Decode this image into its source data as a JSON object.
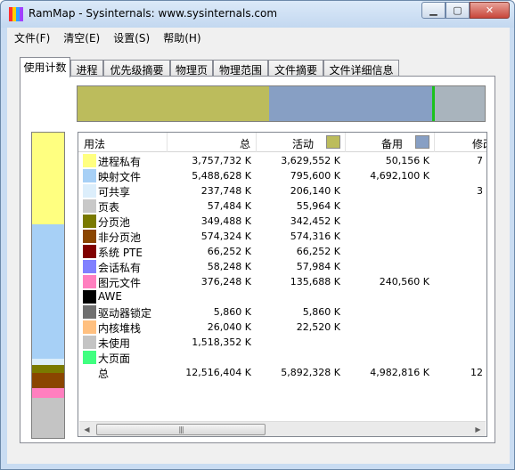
{
  "window": {
    "title": "RamMap - Sysinternals: www.sysinternals.com"
  },
  "menu": [
    "文件(F)",
    "清空(E)",
    "设置(S)",
    "帮助(H)"
  ],
  "tabs": [
    "使用计数",
    "进程",
    "优先级摘要",
    "物理页",
    "物理范围",
    "文件摘要",
    "文件详细信息"
  ],
  "active_tab": "使用计数",
  "topbar": [
    {
      "color": "#bcbc5c",
      "fraction": 0.47
    },
    {
      "color": "#879fc4",
      "fraction": 0.4
    },
    {
      "color": "#1cc21c",
      "fraction": 0.008
    },
    {
      "color": "#a9b4bd",
      "fraction": 0.122
    }
  ],
  "vbar": [
    {
      "color": "#ffff80",
      "fraction": 0.3
    },
    {
      "color": "#a7d0f6",
      "fraction": 0.44
    },
    {
      "color": "#dceefb",
      "fraction": 0.02
    },
    {
      "color": "#7a7a00",
      "fraction": 0.028
    },
    {
      "color": "#8a4500",
      "fraction": 0.048
    },
    {
      "color": "#ff7fbf",
      "fraction": 0.034
    },
    {
      "color": "#c4c4c4",
      "fraction": 0.13
    }
  ],
  "columns": {
    "usage": "用法",
    "total": "总",
    "active": "活动",
    "standby": "备用",
    "modified": "修改",
    "active_color": "#bcbc5c",
    "standby_color": "#879fc4"
  },
  "rows": [
    {
      "name": "进程私有",
      "color": "#ffff80",
      "total": "3,757,732 K",
      "active": "3,629,552 K",
      "standby": "50,156 K",
      "modified": "7"
    },
    {
      "name": "映射文件",
      "color": "#a7d0f6",
      "total": "5,488,628 K",
      "active": "795,600 K",
      "standby": "4,692,100 K",
      "modified": ""
    },
    {
      "name": "可共享",
      "color": "#dceefb",
      "total": "237,748 K",
      "active": "206,140 K",
      "standby": "",
      "modified": "3"
    },
    {
      "name": "页表",
      "color": "#c8c8c8",
      "total": "57,484 K",
      "active": "55,964 K",
      "standby": "",
      "modified": ""
    },
    {
      "name": "分页池",
      "color": "#7a7a00",
      "total": "349,488 K",
      "active": "342,452 K",
      "standby": "",
      "modified": ""
    },
    {
      "name": "非分页池",
      "color": "#8a4500",
      "total": "574,324 K",
      "active": "574,316 K",
      "standby": "",
      "modified": ""
    },
    {
      "name": "系统 PTE",
      "color": "#800000",
      "total": "66,252 K",
      "active": "66,252 K",
      "standby": "",
      "modified": ""
    },
    {
      "name": "会话私有",
      "color": "#8080ff",
      "total": "58,248 K",
      "active": "57,984 K",
      "standby": "",
      "modified": ""
    },
    {
      "name": "图元文件",
      "color": "#ff7fbf",
      "total": "376,248 K",
      "active": "135,688 K",
      "standby": "240,560 K",
      "modified": ""
    },
    {
      "name": "AWE",
      "color": "#000000",
      "total": "",
      "active": "",
      "standby": "",
      "modified": ""
    },
    {
      "name": "驱动器锁定",
      "color": "#707070",
      "total": "5,860 K",
      "active": "5,860 K",
      "standby": "",
      "modified": ""
    },
    {
      "name": "内核堆栈",
      "color": "#ffc080",
      "total": "26,040 K",
      "active": "22,520 K",
      "standby": "",
      "modified": ""
    },
    {
      "name": "未使用",
      "color": "#c4c4c4",
      "total": "1,518,352 K",
      "active": "",
      "standby": "",
      "modified": ""
    },
    {
      "name": "大页面",
      "color": "#40ff80",
      "total": "",
      "active": "",
      "standby": "",
      "modified": ""
    },
    {
      "name": "总",
      "color": "",
      "total": "12,516,404 K",
      "active": "5,892,328 K",
      "standby": "4,982,816 K",
      "modified": "12"
    }
  ],
  "scrollbar": {
    "left_arrow": "◀",
    "right_arrow": "▶",
    "grip": "|||"
  }
}
